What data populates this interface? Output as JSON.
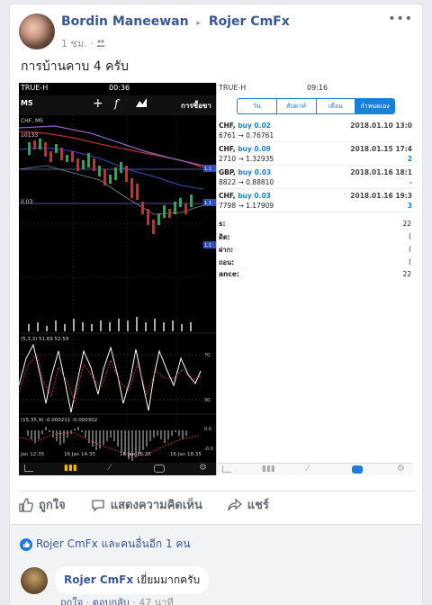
{
  "post": {
    "author": "Bordin Maneewan",
    "separator": "▸",
    "target": "Rojer CmFx",
    "time": "1 ชม. · ",
    "audience_icon": "friends-icon",
    "more": "•••",
    "text": "การบ้านคาบ 4 ครับ"
  },
  "left_screen": {
    "carrier": "TRUE-H",
    "time": "00:36",
    "timeframe": "M5",
    "symbol_partial": "CHF, M5",
    "menu_partial": "การซื้อขา",
    "osc1_label": "(5,3,3) 51.69 52.59",
    "osc2_label": "(15,35,9) -0.000211 -0.000302",
    "price_labels": [
      "10133",
      "0.03"
    ],
    "x_labels": [
      "Jan 12:35",
      "16 Jan 14:35",
      "16 Jan 16:35",
      "16 Jan 18:35"
    ],
    "right_axis": [
      "1.1",
      "1.1",
      "1.1"
    ],
    "osc_axis": [
      "70.",
      "30.",
      "0.0",
      "-0.0"
    ]
  },
  "right_screen": {
    "carrier": "TRUE-H",
    "time": "09:16",
    "tabs": [
      "วัน",
      "สัปดาห์",
      "เดือน",
      "กำหนดเอง"
    ],
    "positions": [
      {
        "pair": "CHF,",
        "side": "buy 0.02",
        "prices": "6761 → 0.76761",
        "date": "2018.01.10 13:0",
        "pl": ""
      },
      {
        "pair": "CHF,",
        "side": "buy 0.09",
        "prices": "2710 → 1.32935",
        "date": "2018.01.15 17:4",
        "pl": "2"
      },
      {
        "pair": "GBP,",
        "side": "buy 0.03",
        "prices": "8822 → 0.88810",
        "date": "2018.01.16 18:1",
        "pl": "-"
      },
      {
        "pair": "CHF,",
        "side": "buy 0.03",
        "prices": "7798 → 1.17909",
        "date": "2018.01.16 19:3",
        "pl": "3"
      }
    ],
    "summary": [
      {
        "label": "s:",
        "value": "22"
      },
      {
        "label": "ดิต:",
        "value": "("
      },
      {
        "label": "ฝาก:",
        "value": "("
      },
      {
        "label": "ถอน:",
        "value": "("
      },
      {
        "label": "ance:",
        "value": "22"
      }
    ]
  },
  "actions": {
    "like": "ถูกใจ",
    "comment": "แสดงความคิดเห็น",
    "share": "แชร์"
  },
  "likes": {
    "text": "Rojer CmFx และคนอื่นอีก 1 คน"
  },
  "comment": {
    "author": "Rojer CmFx",
    "text": "เยี่ยมมากครับ",
    "like": "ถูกใจ",
    "dot": " · ",
    "reply": "ตอบกลับ",
    "time": " · 47 นาที"
  }
}
